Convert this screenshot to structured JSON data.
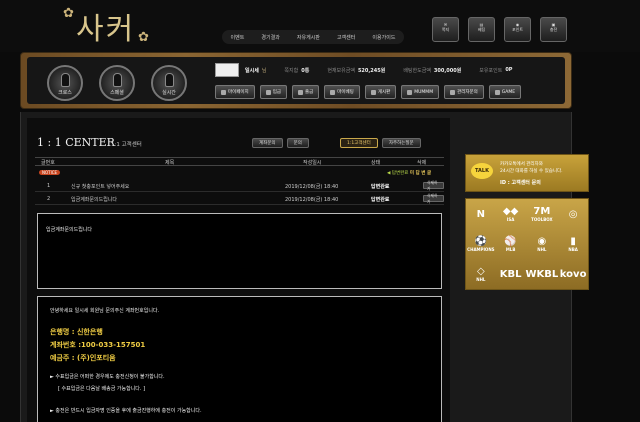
{
  "header": {
    "logo_text": "사커",
    "nav": [
      "이벤트",
      "경기결과",
      "자유게시판",
      "고객센터",
      "이용가이드"
    ],
    "top_buttons": [
      "쪽지",
      "베팅",
      "포인트",
      "충전"
    ]
  },
  "panel": {
    "circles": [
      "크로스",
      "스페셜",
      "실시간"
    ],
    "user": {
      "name": "일시세",
      "level_suffix": "님",
      "points_label": "쪽지함",
      "points_value": "0통",
      "money_label": "현재보유금액",
      "money_value": "520,245원",
      "bet_label": "배팅한도금액",
      "bet_value": "300,000원",
      "holdpoint_label": "보유포인트",
      "holdpoint_value": "0P"
    },
    "menu": [
      "마이페이지",
      "입금",
      "출금",
      "마이베팅",
      "게시판",
      "MUMMM",
      "관리자문의",
      "GAME"
    ]
  },
  "content": {
    "title": "1 : 1 CENTER",
    "subtitle": "1:1 고객센터",
    "buttons_left": [
      "계좌문의",
      "문의"
    ],
    "buttons_right": [
      "1:1고객센터",
      "자주하는질문"
    ],
    "headers": [
      "글번호",
      "제목",
      "작성일시",
      "상태",
      "삭제"
    ],
    "notice_tag": "NOTICE",
    "green_tag": "◀ 답변완료",
    "green_tag_b": "미 답 변 글",
    "rows": [
      {
        "no": "1",
        "title": "신규 첫충포인트 넣어주세요",
        "date": "2019/12/08(금) 18:40",
        "status": "답변완료",
        "del": "삭제하기"
      },
      {
        "no": "2",
        "title": "입금계좌문의드립니다",
        "date": "2019/12/08(금) 18:40",
        "status": "답변완료",
        "del": "삭제하기"
      }
    ],
    "question": "입금계좌문의드립니다",
    "answer": {
      "greeting": "안녕하세요 일시세 회원님 문의주신 계좌번호입니다.",
      "bank": "은행명 : 신한은행",
      "account": "계좌번호 :100-033-157501",
      "holder": "예금주 : (주)인포티움",
      "note1": "► 수표입금은 어떠한 경우에도 충전신청이 불가합니다.",
      "note2": "[ 수표입금은 다음날 배송금 가능합니다. ]",
      "note3": "► 충전은 반드시 입금자명 인증을 후에 출금진행하에 충전이 가능합니다."
    }
  },
  "sidebar": {
    "kakao_badge": "TALK",
    "kakao_l1": "카카오톡에서 관리자와",
    "kakao_l2": "24시간 대화를 하실 수 있습니다.",
    "kakao_l3": "ID : 고객센터 문의",
    "leagues": [
      {
        "mark": "N",
        "name": ""
      },
      {
        "mark": "◆◆",
        "name": "ISA"
      },
      {
        "mark": "7M",
        "name": "TOOLBOX"
      },
      {
        "mark": "◎",
        "name": ""
      },
      {
        "mark": "⚽",
        "name": "CHAMPIONS"
      },
      {
        "mark": "⚾",
        "name": "MLB"
      },
      {
        "mark": "◉",
        "name": "NHL"
      },
      {
        "mark": "▮",
        "name": "NBA"
      },
      {
        "mark": "◇",
        "name": "NHL"
      },
      {
        "mark": "KBL",
        "name": ""
      },
      {
        "mark": "WKBL",
        "name": ""
      },
      {
        "mark": "kovo",
        "name": ""
      }
    ]
  },
  "colors": {
    "gold": "#f0cd44",
    "green": "#b8d84a",
    "notice": "#c8451f"
  }
}
